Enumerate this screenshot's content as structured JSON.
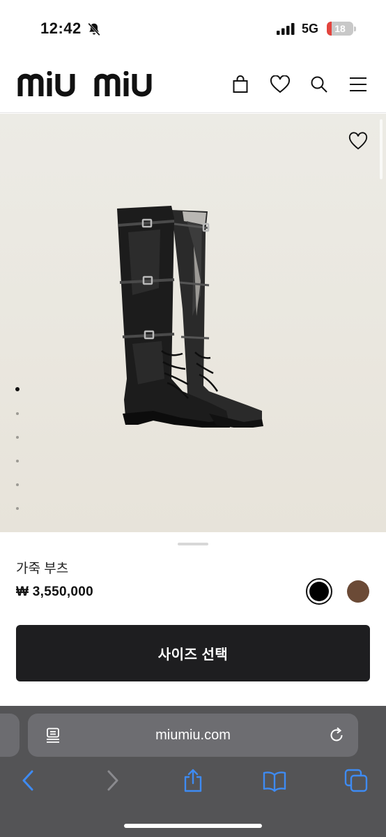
{
  "status": {
    "time": "12:42",
    "network": "5G",
    "battery": "18",
    "battery_level": 0.18
  },
  "header": {
    "logo_text": "miu miu",
    "icons": [
      "shopping-bag-icon",
      "heart-icon",
      "search-icon",
      "menu-icon"
    ]
  },
  "gallery": {
    "image": "black-leather-knee-high-buckle-boots",
    "image_count": 6,
    "active_index": 0
  },
  "product": {
    "name": "가죽 부츠",
    "price": "₩ 3,550,000",
    "colors": [
      {
        "name": "black",
        "hex": "#000000",
        "selected": true
      },
      {
        "name": "brown",
        "hex": "#6b4a36",
        "selected": false
      }
    ],
    "cta_label": "사이즈 선택"
  },
  "browser": {
    "url": "miumiu.com",
    "toolbar": [
      "back-icon",
      "forward-icon",
      "share-icon",
      "bookmarks-icon",
      "tabs-icon"
    ]
  },
  "colors": {
    "accent": "#1e1e20",
    "safari_blue": "#3e8bf3",
    "battery_red": "#e3443d"
  }
}
